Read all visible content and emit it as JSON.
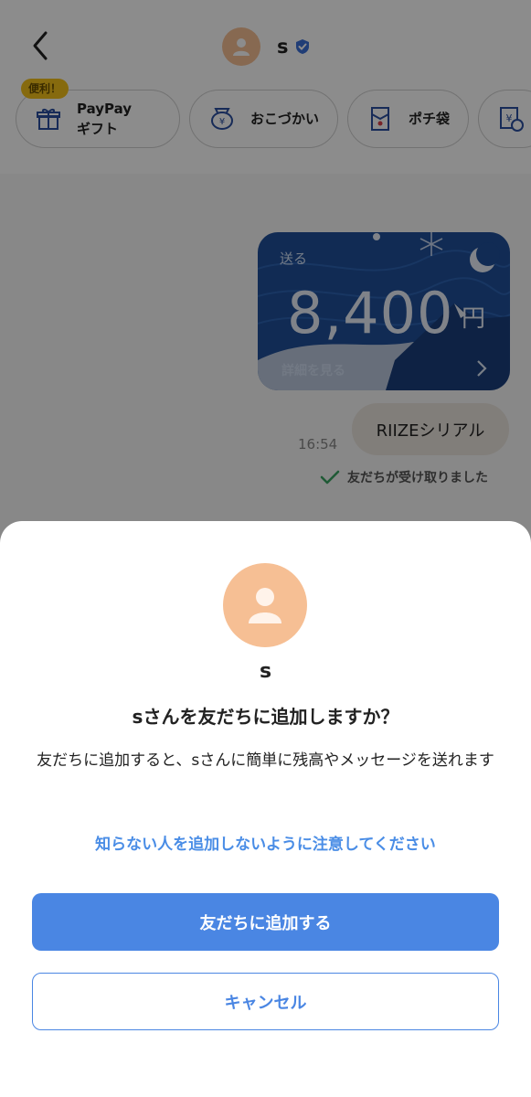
{
  "header": {
    "contact_name": "s"
  },
  "quick_actions": {
    "badge": "便利！",
    "items": [
      {
        "label_line1": "PayPay",
        "label_line2": "ギフト",
        "icon": "gift-icon"
      },
      {
        "label_line1": "おこづかい",
        "label_line2": "",
        "icon": "money-bag-icon"
      },
      {
        "label_line1": "ポチ袋",
        "label_line2": "",
        "icon": "envelope-icon"
      },
      {
        "label_line1": "",
        "label_line2": "",
        "icon": "yen-clock-icon"
      }
    ]
  },
  "chat": {
    "card": {
      "send_label": "送る",
      "amount": "8,400",
      "currency": "円",
      "detail_label": "詳細を見る"
    },
    "message": "RIIZEシリアル",
    "time": "16:54",
    "received_status": "友だちが受け取りました"
  },
  "sheet": {
    "name": "s",
    "question": "sさんを友だちに追加しますか？",
    "description": "友だちに追加すると、sさんに簡単に残高やメッセージを送れます",
    "warning_link": "知らない人を追加しないように注意してください",
    "add_button": "友だちに追加する",
    "cancel_button": "キャンセル"
  },
  "colors": {
    "accent": "#4a86e3",
    "avatar": "#f6bf94",
    "card": "#1f4f99",
    "badge": "#f4c21a"
  }
}
